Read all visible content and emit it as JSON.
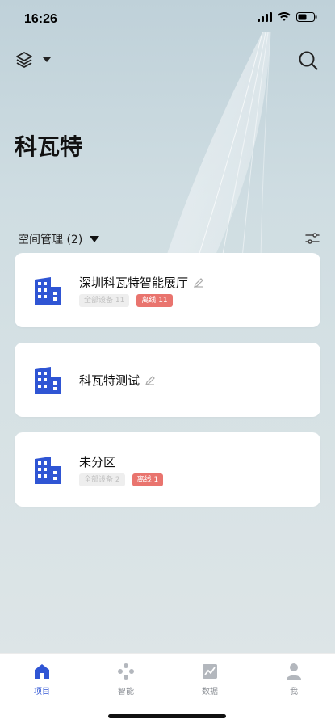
{
  "status_bar": {
    "time": "16:26"
  },
  "header": {
    "title": "科瓦特"
  },
  "section": {
    "label": "空间管理 (2)"
  },
  "cards": [
    {
      "name": "深圳科瓦特智能展厅",
      "badges": [
        {
          "text": "全部设备 11",
          "style": "gray"
        },
        {
          "text": "离线 11",
          "style": "red"
        }
      ]
    },
    {
      "name": "科瓦特测试",
      "badges": []
    },
    {
      "name": "未分区",
      "badges": [
        {
          "text": "全部设备 2",
          "style": "gray"
        },
        {
          "text": "离线 1",
          "style": "red"
        }
      ]
    }
  ],
  "tabs": [
    {
      "label": "项目",
      "icon": "home-icon",
      "active": true
    },
    {
      "label": "智能",
      "icon": "smart-icon",
      "active": false
    },
    {
      "label": "数据",
      "icon": "chart-icon",
      "active": false
    },
    {
      "label": "我",
      "icon": "user-icon",
      "active": false
    }
  ],
  "colors": {
    "accent": "#2f55d4",
    "offline": "#e9746e",
    "inactive": "#b3b7bd"
  }
}
